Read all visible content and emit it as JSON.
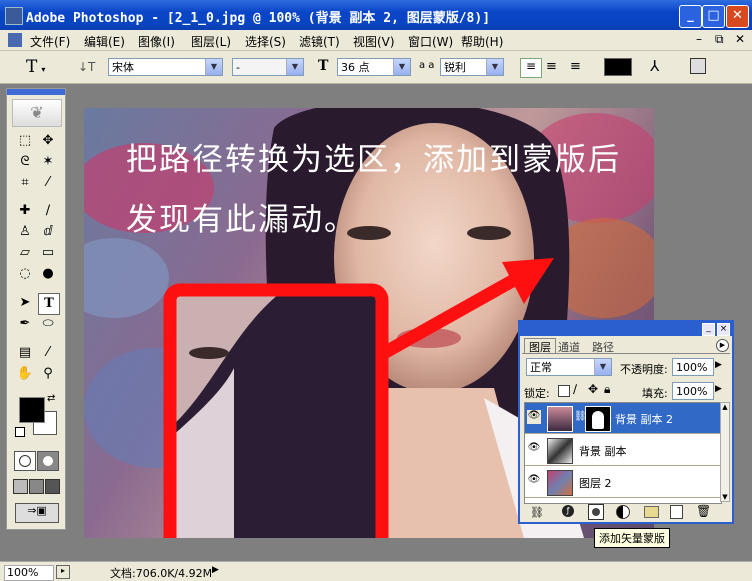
{
  "window": {
    "title": "Adobe Photoshop - [2_1_0.jpg @ 100% (背景 副本 2, 图层蒙版/8)]"
  },
  "menu": [
    "文件(F)",
    "编辑(E)",
    "图像(I)",
    "图层(L)",
    "选择(S)",
    "滤镜(T)",
    "视图(V)",
    "窗口(W)",
    "帮助(H)"
  ],
  "options": {
    "font_family": "宋体",
    "font_style": "-",
    "font_size": "36 点",
    "aa_label": "a a",
    "antialias": "锐利"
  },
  "canvas": {
    "caption_line1": "把路径转换为选区，添加到蒙版后",
    "caption_line2": "发现有此漏动。"
  },
  "colors": {
    "annotation": "#ff1010",
    "xp_blue": "#0a45c8"
  },
  "layers_panel": {
    "tabs": [
      "图层",
      "通道",
      "路径"
    ],
    "blend_mode": "正常",
    "opacity_label": "不透明度:",
    "opacity": "100%",
    "lock_label": "锁定:",
    "fill_label": "填充:",
    "fill": "100%",
    "layers": [
      {
        "name": "背景 副本 2",
        "selected": true
      },
      {
        "name": "背景 副本",
        "selected": false
      },
      {
        "name": "图层 2",
        "selected": false
      }
    ],
    "tooltip": "添加矢量蒙版"
  },
  "status": {
    "zoom": "100%",
    "doc": "文档:706.0K/4.92M"
  }
}
